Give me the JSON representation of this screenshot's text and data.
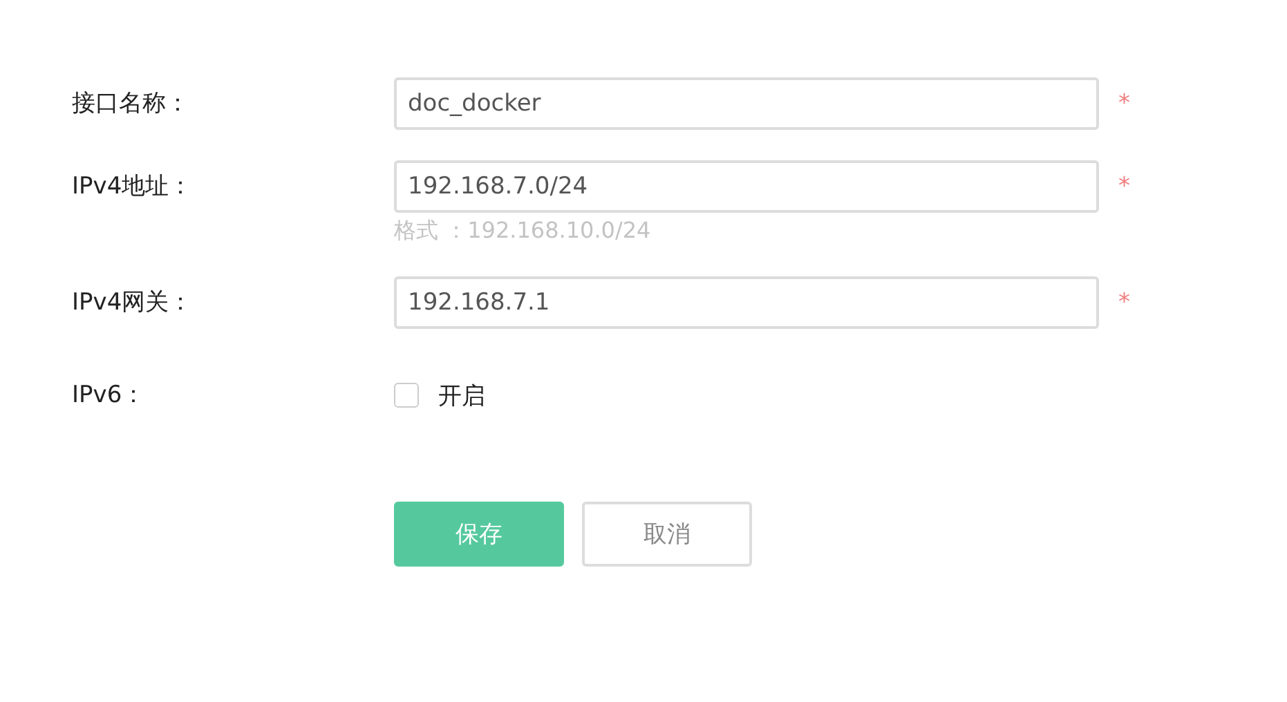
{
  "fields": [
    {
      "kind": "text",
      "label": "接口名称：",
      "value": "doc_docker",
      "required_mark": "*"
    },
    {
      "kind": "text",
      "label": "IPv4地址：",
      "value": "192.168.7.0/24",
      "required_mark": "*",
      "hint": "格式 ：192.168.10.0/24"
    },
    {
      "kind": "text",
      "label": "IPv4网关：",
      "value": "192.168.7.1",
      "required_mark": "*"
    },
    {
      "kind": "checkbox",
      "label": "IPv6：",
      "option": "开启",
      "checked": false
    }
  ],
  "buttons": [
    {
      "kind": "primary",
      "label": "保存"
    },
    {
      "kind": "secondary",
      "label": "取消"
    }
  ]
}
